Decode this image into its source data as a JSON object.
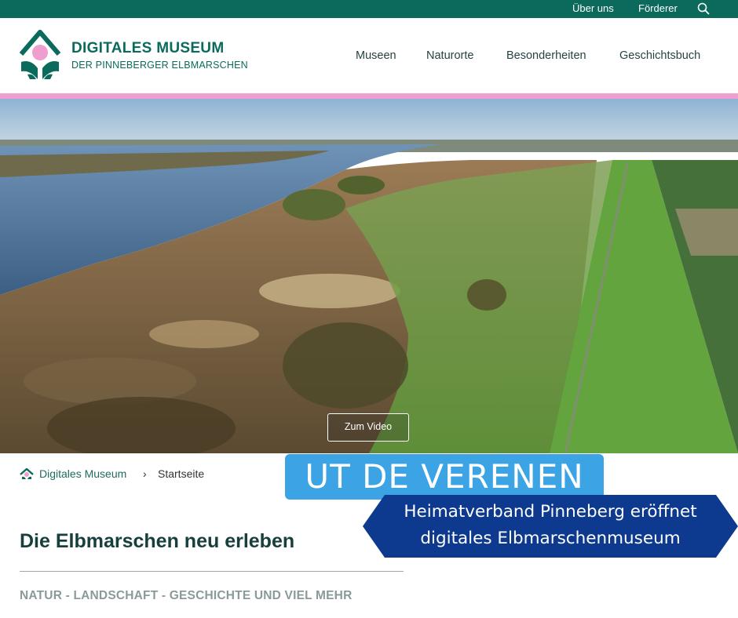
{
  "topbar": {
    "links": [
      "Über uns",
      "Förderer"
    ],
    "search_icon": "search-icon",
    "background": "#0b6a5c"
  },
  "header": {
    "brand_title": "DIGITALES MUSEUM",
    "brand_subtitle": "DER PINNEBERGER ELBMARSCHEN",
    "nav": [
      "Museen",
      "Naturorte",
      "Besonderheiten",
      "Geschichtsbuch"
    ],
    "accent_line_color": "#ef9fcf"
  },
  "hero": {
    "video_button_label": "Zum Video"
  },
  "breadcrumb": {
    "home_icon": "home-icon",
    "items": [
      "Digitales Museum",
      "Startseite"
    ],
    "separator": "›"
  },
  "intro": {
    "headline": "Die Elbmarschen neu erleben",
    "subline": "NATUR - LANDSCHAFT - GESCHICHTE UND VIEL MEHR"
  },
  "overlay": {
    "badge_text": "UT DE VERENEN",
    "badge_color": "#3ca4e4",
    "banner_line1": "Heimatverband Pinneberg eröffnet",
    "banner_line2": "digitales Elbmarschenmuseum",
    "banner_color": "#0d3a8e"
  }
}
